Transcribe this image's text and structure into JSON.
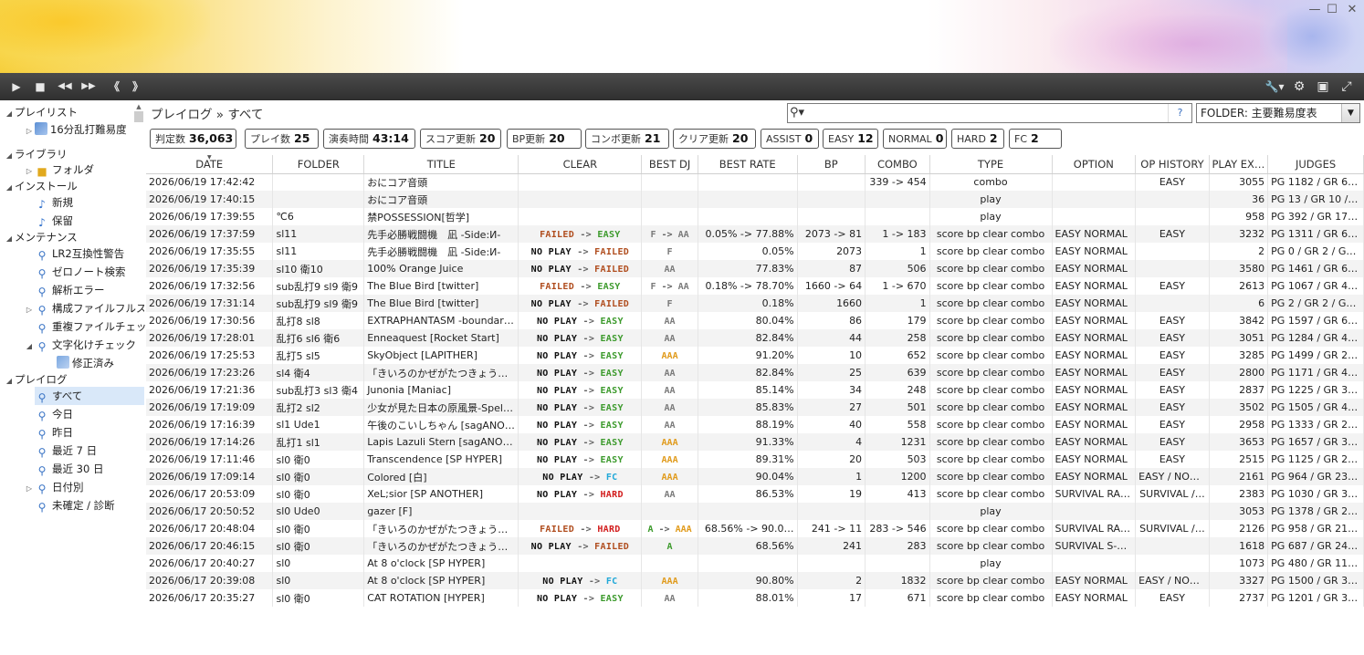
{
  "window": {
    "minimize": "—",
    "maximize": "☐",
    "close": "✕"
  },
  "toolbar": {
    "play": "▶",
    "stop": "■",
    "rewind": "◀◀",
    "forward": "▶▶",
    "prev": "《",
    "next": "》",
    "tools": "🔧▾",
    "settings": "⚙",
    "image": "▣",
    "fullscreen": "⤢"
  },
  "sidebar": {
    "playlist": "プレイリスト",
    "playlist_item": "16分乱打難易度",
    "library": "ライブラリ",
    "folder": "フォルダ",
    "install": "インストール",
    "new": "新規",
    "pending": "保留",
    "maintenance": "メンテナンス",
    "lr2_warning": "LR2互換性警告",
    "zero_note": "ゼロノート検索",
    "parse_error": "解析エラー",
    "config_path": "構成ファイルフルスキャン",
    "dup_check": "重複ファイルチェック",
    "mojibake": "文字化けチェック",
    "fixed": "修正済み",
    "playlog": "プレイログ",
    "all": "すべて",
    "today": "今日",
    "yesterday": "昨日",
    "last7": "最近 7 日",
    "last30": "最近 30 日",
    "by_date": "日付別",
    "unconfirmed": "未確定 / 診断"
  },
  "main": {
    "breadcrumb": "プレイログ » すべて",
    "search_placeholder": "",
    "search_help": "?",
    "folder_select": "FOLDER: 主要難易度表"
  },
  "stats": [
    {
      "label": "判定数",
      "value": "36,063"
    },
    {
      "label": "プレイ数",
      "value": "25"
    },
    {
      "label": "演奏時間",
      "value": "43:14"
    },
    {
      "label": "スコア更新",
      "value": "20"
    },
    {
      "label": "BP更新",
      "value": "20"
    },
    {
      "label": "コンボ更新",
      "value": "21"
    },
    {
      "label": "クリア更新",
      "value": "20"
    },
    {
      "label": "ASSIST",
      "value": "0"
    },
    {
      "label": "EASY",
      "value": "12"
    },
    {
      "label": "NORMAL",
      "value": "0"
    },
    {
      "label": "HARD",
      "value": "2"
    },
    {
      "label": "FC",
      "value": "2"
    }
  ],
  "columns": [
    "DATE",
    "FOLDER",
    "TITLE",
    "CLEAR",
    "BEST DJ",
    "BEST RATE",
    "BP",
    "COMBO",
    "TYPE",
    "OPTION",
    "OP HISTORY",
    "PLAY EX…",
    "JUDGES"
  ],
  "rows": [
    [
      "2026/06/19 17:42:42",
      "",
      "おにコア音頭",
      "",
      "",
      "",
      "",
      "339 -> 454",
      "combo",
      "",
      "EASY",
      "3055",
      "PG 1182 / GR 6…"
    ],
    [
      "2026/06/19 17:40:15",
      "",
      "おにコア音頭",
      "",
      "",
      "",
      "",
      "",
      "play",
      "",
      "",
      "36",
      "PG 13 / GR 10 /…"
    ],
    [
      "2026/06/19 17:39:55",
      "℃6",
      "禁POSSESSION[哲学]",
      "",
      "",
      "",
      "",
      "",
      "play",
      "",
      "",
      "958",
      "PG 392 / GR 17…"
    ],
    [
      "2026/06/19 17:37:59",
      "sl11",
      "先手必勝戦闘機　凪 -Side:И-",
      "FAILED -> EASY",
      "F -> AA",
      "0.05% -> 77.88%",
      "2073 -> 81",
      "1 -> 183",
      "score bp clear combo",
      "EASY NORMAL",
      "EASY",
      "3232",
      "PG 1311 / GR 6…"
    ],
    [
      "2026/06/19 17:35:55",
      "sl11",
      "先手必勝戦闘機　凪 -Side:И-",
      "NO PLAY -> FAILED",
      "F",
      "0.05%",
      "2073",
      "1",
      "score bp clear combo",
      "EASY NORMAL",
      "",
      "2",
      "PG 0 / GR 2 / G…"
    ],
    [
      "2026/06/19 17:35:39",
      "sl10 衛10",
      "100% Orange Juice",
      "NO PLAY -> FAILED",
      "AA",
      "77.83%",
      "87",
      "506",
      "score bp clear combo",
      "EASY NORMAL",
      "",
      "3580",
      "PG 1461 / GR 6…"
    ],
    [
      "2026/06/19 17:32:56",
      "sub乱打9 sl9 衛9",
      "The Blue Bird [twitter]",
      "FAILED -> EASY",
      "F -> AA",
      "0.18% -> 78.70%",
      "1660 -> 64",
      "1 -> 670",
      "score bp clear combo",
      "EASY NORMAL",
      "EASY",
      "2613",
      "PG 1067 / GR 4…"
    ],
    [
      "2026/06/19 17:31:14",
      "sub乱打9 sl9 衛9",
      "The Blue Bird [twitter]",
      "NO PLAY -> FAILED",
      "F",
      "0.18%",
      "1660",
      "1",
      "score bp clear combo",
      "EASY NORMAL",
      "",
      "6",
      "PG 2 / GR 2 / G…"
    ],
    [
      "2026/06/19 17:30:56",
      "乱打8 sl8",
      "EXTRAPHANTASM -boundari…",
      "NO PLAY -> EASY",
      "AA",
      "80.04%",
      "86",
      "179",
      "score bp clear combo",
      "EASY NORMAL",
      "EASY",
      "3842",
      "PG 1597 / GR 6…"
    ],
    [
      "2026/06/19 17:28:01",
      "乱打6 sl6 衛6",
      "Enneaquest [Rocket Start]",
      "NO PLAY -> EASY",
      "AA",
      "82.84%",
      "44",
      "258",
      "score bp clear combo",
      "EASY NORMAL",
      "EASY",
      "3051",
      "PG 1284 / GR 4…"
    ],
    [
      "2026/06/19 17:25:53",
      "乱打5 sl5",
      "SkyObject [LAPITHER]",
      "NO PLAY -> EASY",
      "AAA",
      "91.20%",
      "10",
      "652",
      "score bp clear combo",
      "EASY NORMAL",
      "EASY",
      "3285",
      "PG 1499 / GR 2…"
    ],
    [
      "2026/06/19 17:23:26",
      "sl4 衛4",
      "「きいろのかぜがたつきょうこくより」[…",
      "NO PLAY -> EASY",
      "AA",
      "82.84%",
      "25",
      "639",
      "score bp clear combo",
      "EASY NORMAL",
      "EASY",
      "2800",
      "PG 1171 / GR 4…"
    ],
    [
      "2026/06/19 17:21:36",
      "sub乱打3 sl3 衛4",
      "Junonia [Maniac]",
      "NO PLAY -> EASY",
      "AA",
      "85.14%",
      "34",
      "248",
      "score bp clear combo",
      "EASY NORMAL",
      "EASY",
      "2837",
      "PG 1225 / GR 3…"
    ],
    [
      "2026/06/19 17:19:09",
      "乱打2 sl2",
      "少女が見た日本の原風景-Spell…",
      "NO PLAY -> EASY",
      "AA",
      "85.83%",
      "27",
      "501",
      "score bp clear combo",
      "EASY NORMAL",
      "EASY",
      "3502",
      "PG 1505 / GR 4…"
    ],
    [
      "2026/06/19 17:16:39",
      "sl1 Ude1",
      "午後のこいしちゃん [sagANOTH…",
      "NO PLAY -> EASY",
      "AA",
      "88.19%",
      "40",
      "558",
      "score bp clear combo",
      "EASY NORMAL",
      "EASY",
      "2958",
      "PG 1333 / GR 2…"
    ],
    [
      "2026/06/19 17:14:26",
      "乱打1 sl1",
      "Lapis Lazuli Stern [sagANOT…",
      "NO PLAY -> EASY",
      "AAA",
      "91.33%",
      "4",
      "1231",
      "score bp clear combo",
      "EASY NORMAL",
      "EASY",
      "3653",
      "PG 1657 / GR 3…"
    ],
    [
      "2026/06/19 17:11:46",
      "sl0 衛0",
      "Transcendence [SP HYPER]",
      "NO PLAY -> EASY",
      "AAA",
      "89.31%",
      "20",
      "503",
      "score bp clear combo",
      "EASY NORMAL",
      "EASY",
      "2515",
      "PG 1125 / GR 2…"
    ],
    [
      "2026/06/19 17:09:14",
      "sl0 衛0",
      "Colored [白]",
      "NO PLAY -> FC",
      "AAA",
      "90.04%",
      "1",
      "1200",
      "score bp clear combo",
      "EASY NORMAL",
      "EASY / NOR…",
      "2161",
      "PG 964 / GR 23…"
    ],
    [
      "2026/06/17 20:53:09",
      "sl0 衛0",
      "XeL;sior [SP ANOTHER]",
      "NO PLAY -> HARD",
      "AA",
      "86.53%",
      "19",
      "413",
      "score bp clear combo",
      "SURVIVAL RA…",
      "SURVIVAL /…",
      "2383",
      "PG 1030 / GR 3…"
    ],
    [
      "2026/06/17 20:50:52",
      "sl0 Ude0",
      "gazer [F]",
      "",
      "",
      "",
      "",
      "",
      "play",
      "",
      "",
      "3053",
      "PG 1378 / GR 2…"
    ],
    [
      "2026/06/17 20:48:04",
      "sl0 衛0",
      "「きいろのかぜがたつきょうこくより」[…",
      "FAILED -> HARD",
      "A -> AAA",
      "68.56% -> 90.0…",
      "241 -> 11",
      "283 -> 546",
      "score bp clear combo",
      "SURVIVAL RA…",
      "SURVIVAL /…",
      "2126",
      "PG 958 / GR 21…"
    ],
    [
      "2026/06/17 20:46:15",
      "sl0 衛0",
      "「きいろのかぜがたつきょうこくより」[…",
      "NO PLAY -> FAILED",
      "A",
      "68.56%",
      "241",
      "283",
      "score bp clear combo",
      "SURVIVAL S-…",
      "",
      "1618",
      "PG 687 / GR 24…"
    ],
    [
      "2026/06/17 20:40:27",
      "sl0",
      "At 8 o'clock [SP HYPER]",
      "",
      "",
      "",
      "",
      "",
      "play",
      "",
      "",
      "1073",
      "PG 480 / GR 11…"
    ],
    [
      "2026/06/17 20:39:08",
      "sl0",
      "At 8 o'clock [SP HYPER]",
      "NO PLAY -> FC",
      "AAA",
      "90.80%",
      "2",
      "1832",
      "score bp clear combo",
      "EASY NORMAL",
      "EASY / NOR…",
      "3327",
      "PG 1500 / GR 3…"
    ],
    [
      "2026/06/17 20:35:27",
      "sl0 衛0",
      "CAT ROTATION [HYPER]",
      "NO PLAY -> EASY",
      "AA",
      "88.01%",
      "17",
      "671",
      "score bp clear combo",
      "EASY NORMAL",
      "EASY",
      "2737",
      "PG 1201 / GR 3…"
    ]
  ]
}
